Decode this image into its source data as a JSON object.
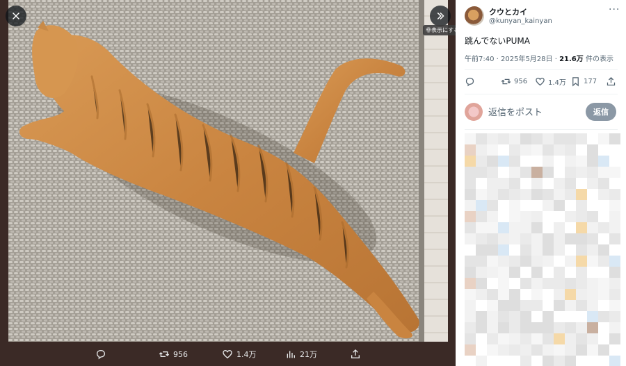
{
  "viewer": {
    "tooltip": "非表示にする",
    "actions": {
      "retweets": "956",
      "likes": "1.4万",
      "views": "21万"
    }
  },
  "tweet": {
    "display_name": "クウとカイ",
    "handle": "@kunyan_kainyan",
    "text": "跳んでないPUMA",
    "time_date": "午前7:40 · 2025年5月28日 · ",
    "views_count": "21.6万",
    "views_suffix": " 件の表示",
    "stats": {
      "retweets": "956",
      "likes": "1.4万",
      "bookmarks": "177"
    }
  },
  "reply": {
    "placeholder": "返信をポスト",
    "button": "返信"
  },
  "colors": {
    "accent_gray": "#8b98a5",
    "viewer_bg": "#3b2a26",
    "text_secondary": "#536471"
  },
  "icons": [
    "close-icon",
    "collapse-panel-icon",
    "reply-icon",
    "retweet-icon",
    "like-icon",
    "views-icon",
    "share-icon",
    "more-icon",
    "bookmark-icon"
  ]
}
